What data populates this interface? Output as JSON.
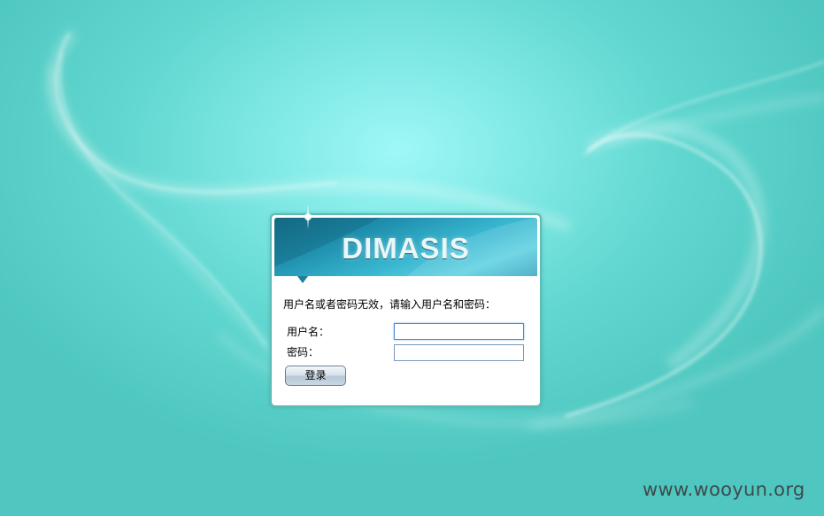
{
  "page": {
    "background_color": "#5fd6cf",
    "highlight_color": "#9ef8f6"
  },
  "login": {
    "brand": "DIMASIS",
    "brand_color": "#1f8fad",
    "message": "用户名或者密码无效，请输入用户名和密码：",
    "username_label": "用户名：",
    "username_value": "",
    "password_label": "密码：",
    "password_value": "",
    "submit_label": "登录"
  },
  "watermark": {
    "text": "www.wooyun.org"
  },
  "icons": {
    "sparkle": "sparkle-icon",
    "pointer": "banner-pointer-icon"
  }
}
